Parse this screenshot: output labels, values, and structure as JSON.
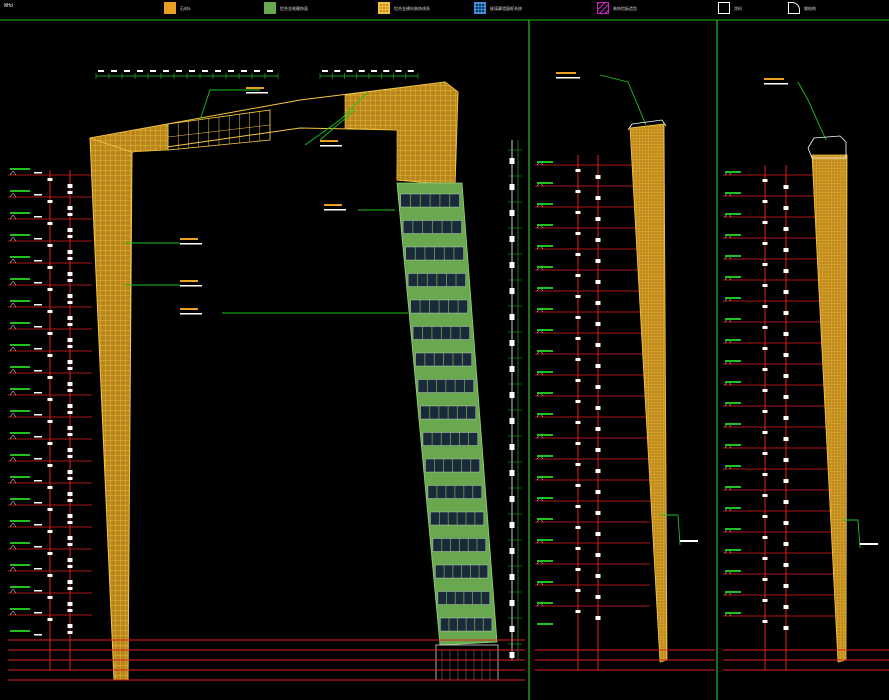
{
  "drawing": {
    "title": "WHd",
    "legend": [
      {
        "label": "石材a",
        "fill": "#e8a020",
        "stroke": "#e8a020",
        "pattern": "solid"
      },
      {
        "label": "铝合金格栅饰面",
        "fill": "#6aa84f",
        "stroke": "#6aa84f",
        "pattern": "solid"
      },
      {
        "label": "铝合金横向装饰线条",
        "fill": "#c98b2a",
        "stroke": "#f0c040",
        "pattern": "grid"
      },
      {
        "label": "玻璃幕墙窗框系统",
        "fill": "#0a2a4a",
        "stroke": "#3a8ee0",
        "pattern": "grid"
      },
      {
        "label": "装饰铝板造型",
        "fill": "#000000",
        "stroke": "#d020d0",
        "pattern": "diagonal"
      },
      {
        "label": "涂料",
        "fill": "#000000",
        "stroke": "#ffffff",
        "pattern": "outline"
      },
      {
        "label": "钢结构",
        "fill": "#000000",
        "stroke": "#ffffff",
        "pattern": "curve"
      }
    ],
    "colors": {
      "background": "#000000",
      "stone": "#e8a020",
      "stone_line": "#f5c842",
      "green_panel": "#6aa84f",
      "window": "#1a2a3a",
      "level_line": "#e02020",
      "leader": "#20c020",
      "divider": "#20c020",
      "dim_text": "#ffffff"
    }
  }
}
